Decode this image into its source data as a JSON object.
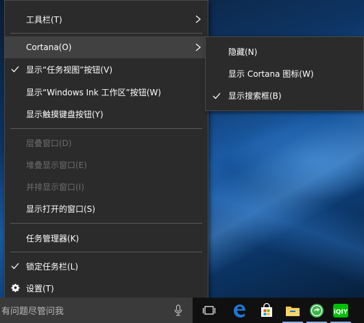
{
  "menu": {
    "items": [
      {
        "label": "工具栏(T)",
        "submenu": true
      },
      {
        "label": "Cortana(O)",
        "submenu": true,
        "highlighted": true
      },
      {
        "label": "显示“任务视图”按钮(V)",
        "checked": true
      },
      {
        "label": "显示“Windows Ink 工作区”按钮(W)"
      },
      {
        "label": "显示触摸键盘按钮(Y)"
      },
      {
        "label": "层叠窗口(D)",
        "disabled": true
      },
      {
        "label": "堆叠显示窗口(E)",
        "disabled": true
      },
      {
        "label": "并排显示窗口(I)",
        "disabled": true
      },
      {
        "label": "显示打开的窗口(S)"
      },
      {
        "label": "任务管理器(K)"
      },
      {
        "label": "锁定任务栏(L)",
        "checked": true
      },
      {
        "label": "设置(T)",
        "icon": "gear-icon"
      }
    ]
  },
  "submenu": {
    "items": [
      {
        "label": "隐藏(N)"
      },
      {
        "label": "显示 Cortana 图标(W)"
      },
      {
        "label": "显示搜索框(B)",
        "checked": true
      }
    ]
  },
  "taskbar": {
    "search_placeholder": "有问题尽管问我",
    "icons": [
      "task-view-icon",
      "edge-icon",
      "store-icon",
      "file-explorer-icon",
      "green-app-icon",
      "iqiyi-icon"
    ],
    "iqiyi_text": "iQIY"
  },
  "colors": {
    "menu_bg": "#2b2b2b",
    "highlight": "#414141",
    "disabled_text": "#6d6d6d",
    "taskbar_bg": "#101010",
    "search_bg": "#3a3a3a",
    "edge_blue": "#1e78d7",
    "folder_yellow": "#f2c94c",
    "green_app": "#3bb34a",
    "iqiyi_green": "#00be06"
  }
}
